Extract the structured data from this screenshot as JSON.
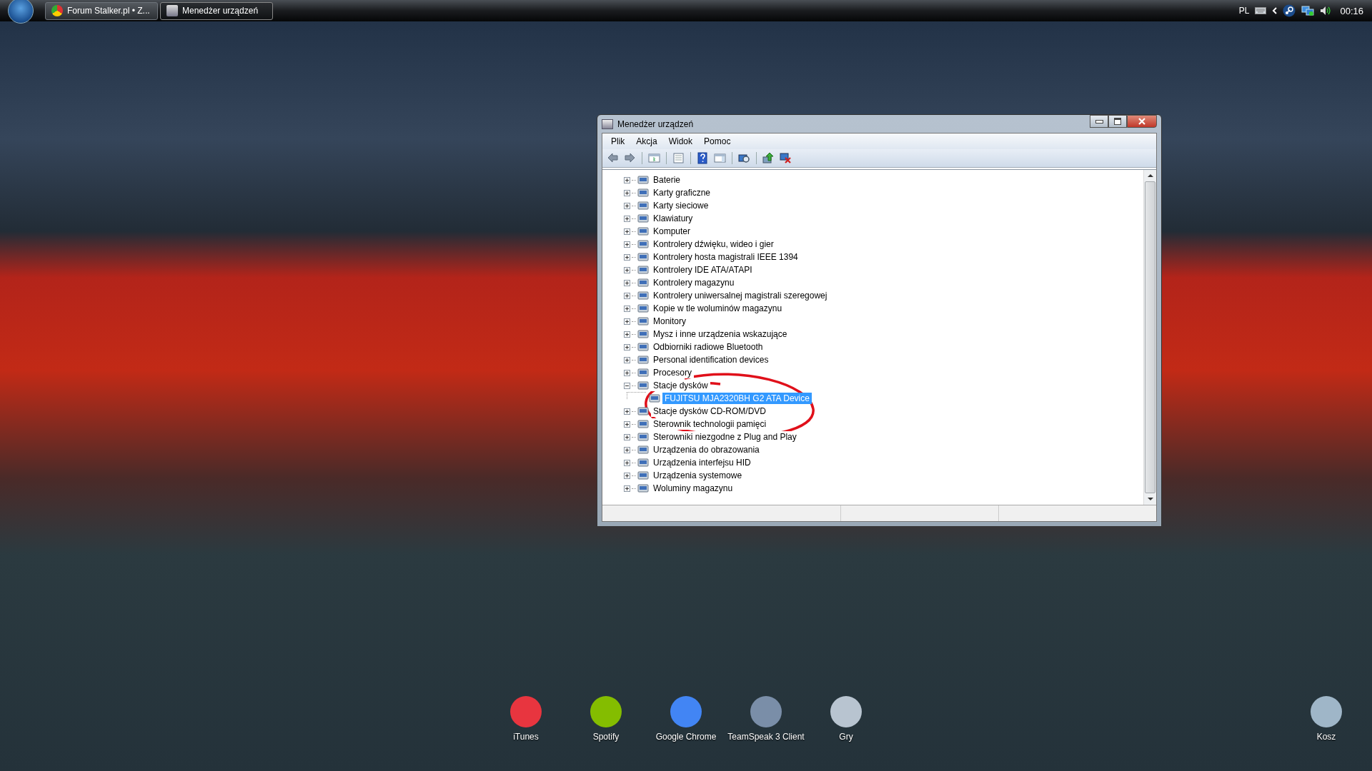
{
  "taskbar": {
    "buttons": [
      {
        "label": "Forum Stalker.pl • Z...",
        "kind": "browser",
        "selected": false
      },
      {
        "label": "Menedżer urządzeń",
        "kind": "devmgr",
        "selected": true
      }
    ],
    "tray": {
      "language": "PL",
      "clock": "00:16"
    }
  },
  "window": {
    "title": "Menedżer urządzeń",
    "menu": [
      "Plik",
      "Akcja",
      "Widok",
      "Pomoc"
    ],
    "tree": [
      {
        "label": "Baterie",
        "expanded": false,
        "selected": false
      },
      {
        "label": "Karty graficzne",
        "expanded": false,
        "selected": false
      },
      {
        "label": "Karty sieciowe",
        "expanded": false,
        "selected": false
      },
      {
        "label": "Klawiatury",
        "expanded": false,
        "selected": false
      },
      {
        "label": "Komputer",
        "expanded": false,
        "selected": false
      },
      {
        "label": "Kontrolery dźwięku, wideo i gier",
        "expanded": false,
        "selected": false
      },
      {
        "label": "Kontrolery hosta magistrali IEEE 1394",
        "expanded": false,
        "selected": false
      },
      {
        "label": "Kontrolery IDE ATA/ATAPI",
        "expanded": false,
        "selected": false
      },
      {
        "label": "Kontrolery magazynu",
        "expanded": false,
        "selected": false
      },
      {
        "label": "Kontrolery uniwersalnej magistrali szeregowej",
        "expanded": false,
        "selected": false
      },
      {
        "label": "Kopie w tle woluminów magazynu",
        "expanded": false,
        "selected": false
      },
      {
        "label": "Monitory",
        "expanded": false,
        "selected": false
      },
      {
        "label": "Mysz i inne urządzenia wskazujące",
        "expanded": false,
        "selected": false
      },
      {
        "label": "Odbiorniki radiowe Bluetooth",
        "expanded": false,
        "selected": false
      },
      {
        "label": "Personal identification devices",
        "expanded": false,
        "selected": false
      },
      {
        "label": "Procesory",
        "expanded": false,
        "selected": false
      },
      {
        "label": "Stacje dysków",
        "expanded": true,
        "selected": false,
        "children": [
          {
            "label": "FUJITSU MJA2320BH G2 ATA Device",
            "selected": true
          }
        ]
      },
      {
        "label": "Stacje dysków CD-ROM/DVD",
        "expanded": false,
        "selected": false
      },
      {
        "label": "Sterownik technologii pamięci",
        "expanded": false,
        "selected": false
      },
      {
        "label": "Sterowniki niezgodne z Plug and Play",
        "expanded": false,
        "selected": false
      },
      {
        "label": "Urządzenia do obrazowania",
        "expanded": false,
        "selected": false
      },
      {
        "label": "Urządzenia interfejsu HID",
        "expanded": false,
        "selected": false
      },
      {
        "label": "Urządzenia systemowe",
        "expanded": false,
        "selected": false
      },
      {
        "label": "Woluminy magazynu",
        "expanded": false,
        "selected": false
      }
    ]
  },
  "desktop_icons": [
    {
      "label": "iTunes",
      "color": "#e8353f"
    },
    {
      "label": "Spotify",
      "color": "#84bd00"
    },
    {
      "label": "Google Chrome",
      "color": "#4285f4"
    },
    {
      "label": "TeamSpeak 3 Client",
      "color": "#7a8ea8"
    },
    {
      "label": "Gry",
      "color": "#b8c4d0"
    },
    {
      "label": "Kosz",
      "color": "#9fb6c8"
    }
  ]
}
